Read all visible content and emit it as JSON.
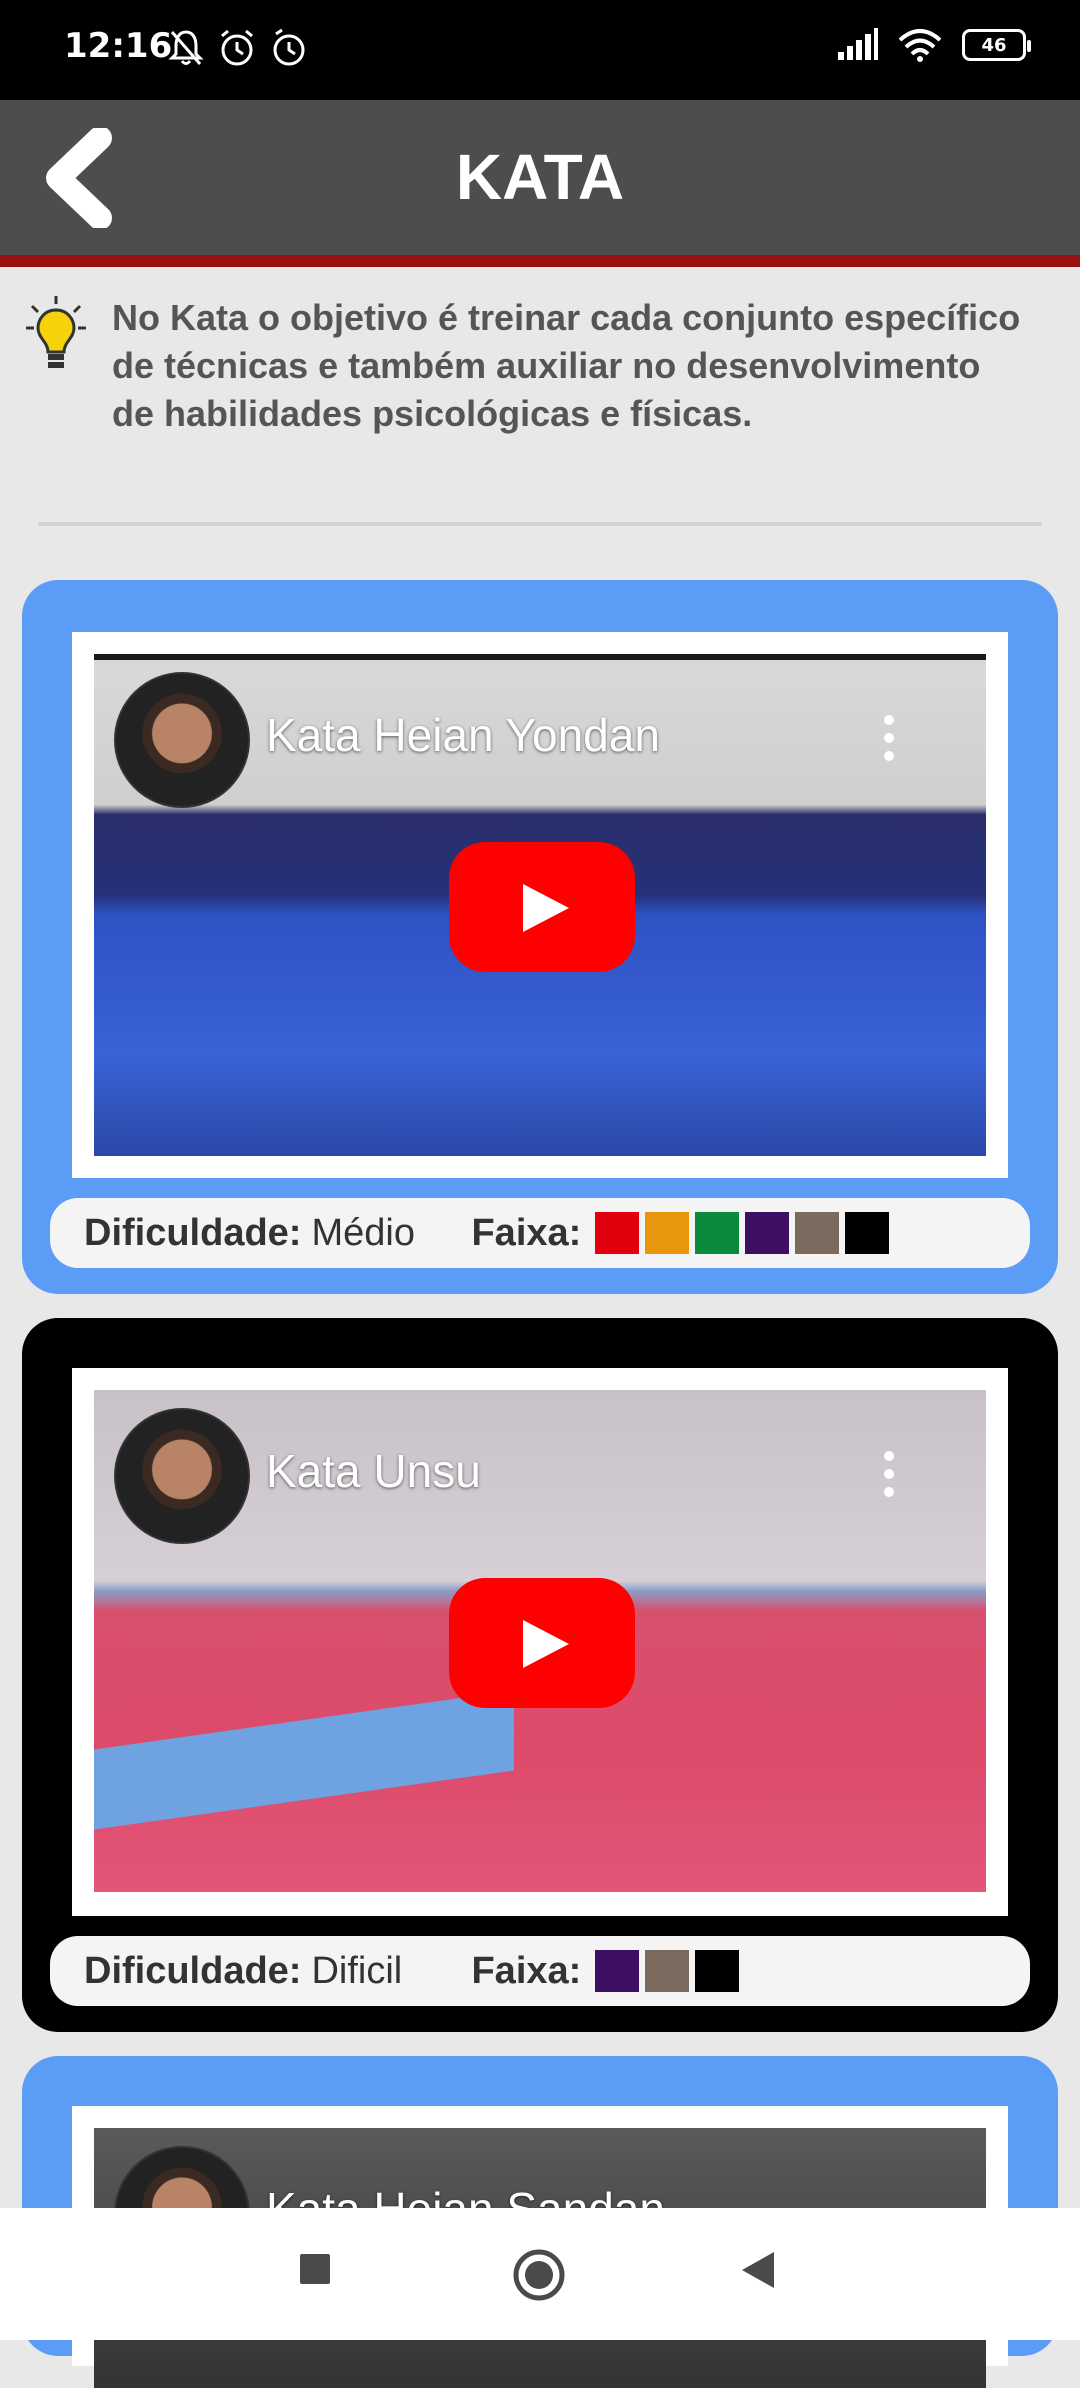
{
  "status_bar": {
    "time": "12:16",
    "battery": "46",
    "icons_left": [
      "mute-bell-icon",
      "alarm-icon",
      "clock-icon"
    ],
    "icons_right": [
      "signal-icon",
      "wifi-icon",
      "battery-icon"
    ]
  },
  "header": {
    "title": "KATA",
    "back_icon": "chevron-left-icon",
    "background": "#4d4d4d",
    "accent": "#9b1111"
  },
  "info": {
    "icon": "lightbulb-icon",
    "text": "No Kata o objetivo é treinar cada conjunto específico de técnicas e também auxiliar no desenvolvimento de habilidades psicológicas e físicas."
  },
  "cards": [
    {
      "border_color": "#5b9cf6",
      "video_title": "Kata Heian Yondan",
      "difficulty_label": "Dificuldade:",
      "difficulty": "Médio",
      "belt_label": "Faixa:",
      "belts": [
        "#e0000e",
        "#e8960c",
        "#0a8a3a",
        "#3c0f63",
        "#7b6a5e",
        "#000000"
      ]
    },
    {
      "border_color": "#000000",
      "video_title": "Kata Unsu",
      "difficulty_label": "Dificuldade:",
      "difficulty": "Dificil",
      "belt_label": "Faixa:",
      "belts": [
        "#3c0f63",
        "#7b6a5e",
        "#000000"
      ]
    },
    {
      "border_color": "#5b9cf6",
      "video_title": "Kata Heian Sandan"
    }
  ],
  "nav": {
    "items": [
      "recents-square-icon",
      "home-circle-icon",
      "back-triangle-icon"
    ]
  }
}
